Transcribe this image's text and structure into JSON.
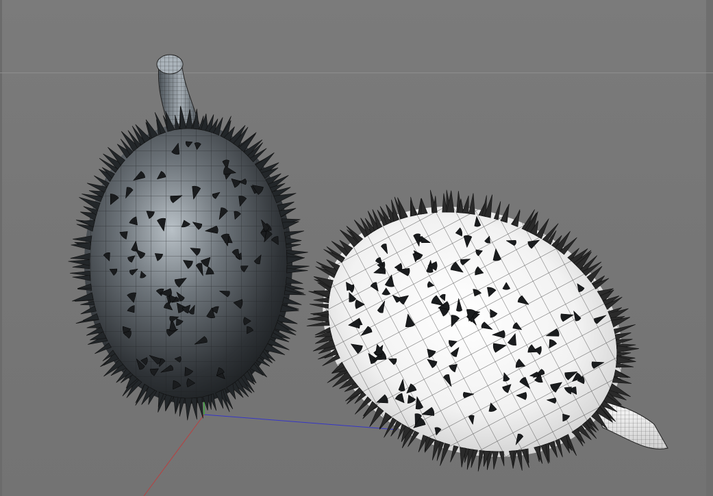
{
  "viewport": {
    "background": "#777777",
    "objects": [
      {
        "name": "durian-upright",
        "shading": "dark-grey"
      },
      {
        "name": "durian-lying",
        "shading": "light-white"
      }
    ],
    "axes": {
      "x_color": "#c03a3a",
      "y_color": "#3aa03a",
      "z_color": "#3a3ad0"
    }
  }
}
